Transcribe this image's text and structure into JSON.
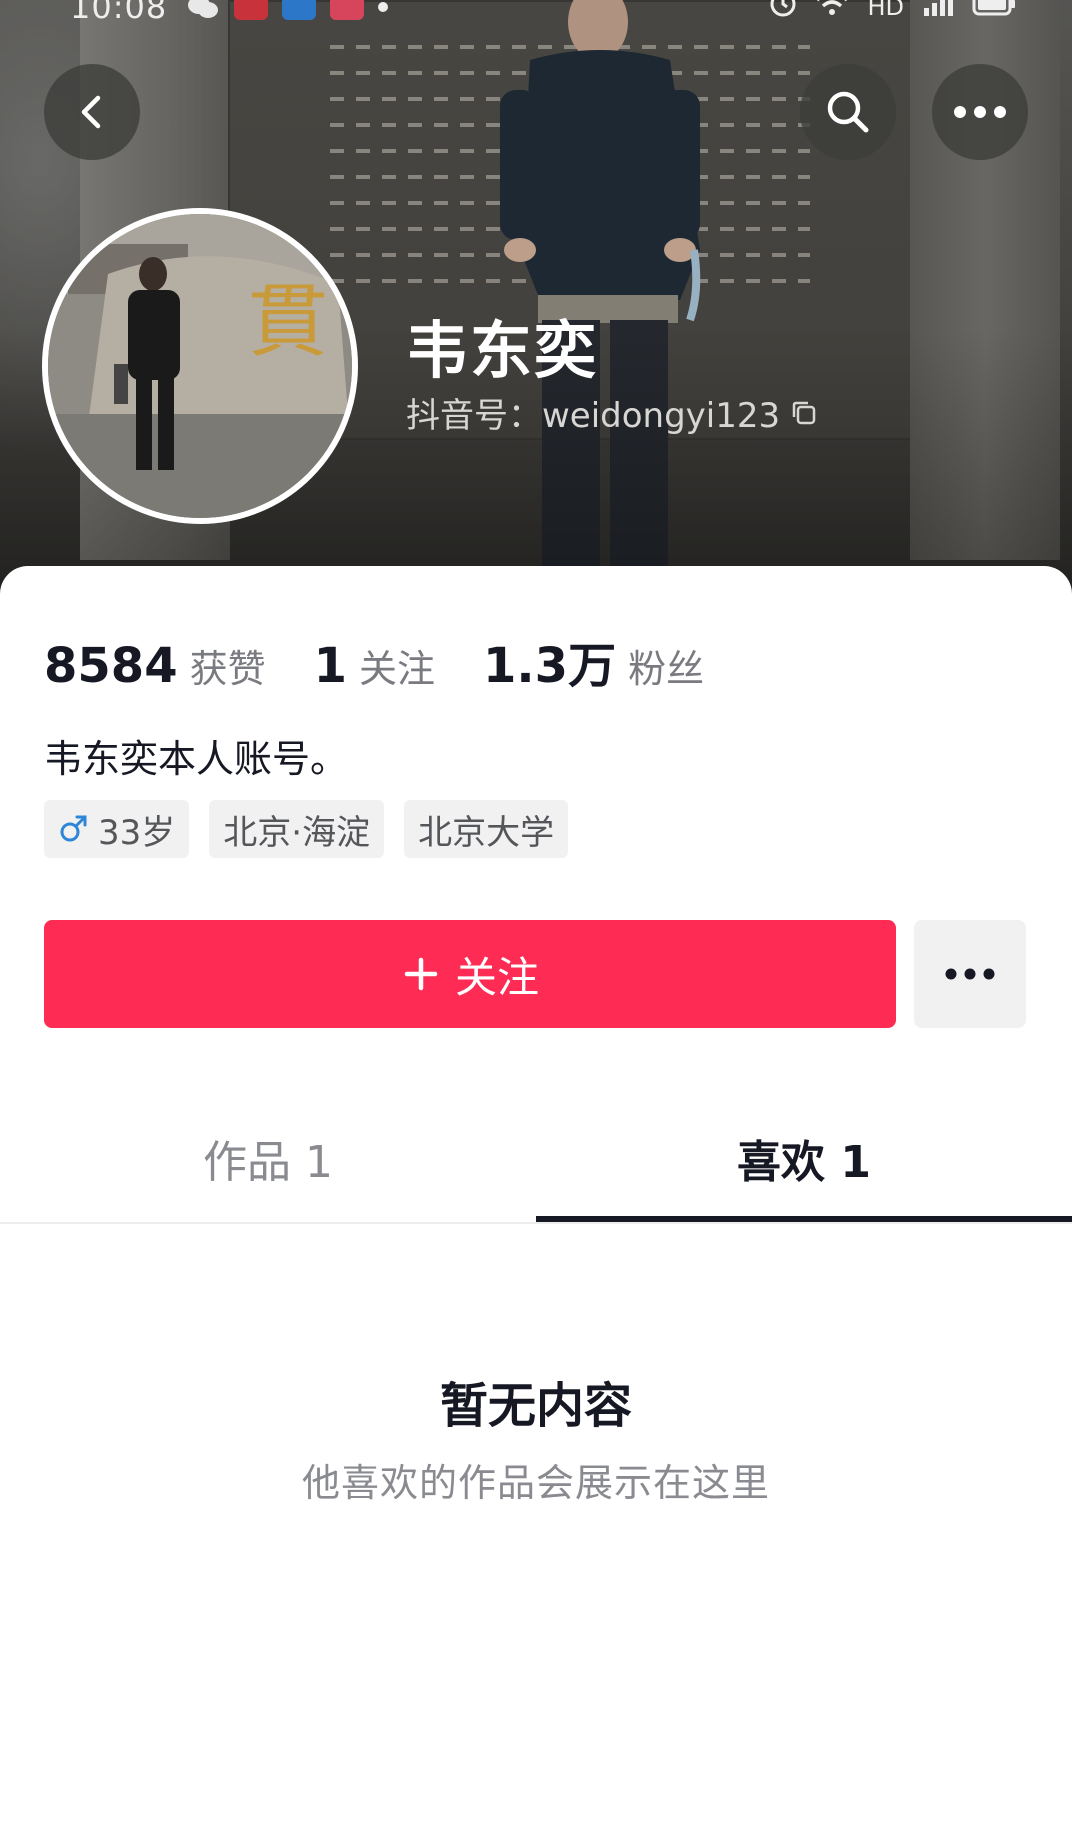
{
  "status_bar": {
    "time": "10:08",
    "network": "HD"
  },
  "header": {
    "back_icon": "chevron-left-icon",
    "search_icon": "search-icon",
    "more_icon": "more-horizontal-icon"
  },
  "profile": {
    "name": "韦东奕",
    "douyin_id": "抖音号：weidongyi123",
    "copy_icon": "copy-icon"
  },
  "stats": [
    {
      "value": "8584",
      "label": "获赞"
    },
    {
      "value": "1",
      "label": "关注"
    },
    {
      "value": "1.3万",
      "label": "粉丝"
    }
  ],
  "bio": "韦东奕本人账号。",
  "tags": [
    {
      "icon": "male-icon",
      "label": "33岁"
    },
    {
      "label": "北京·海淀"
    },
    {
      "label": "北京大学"
    }
  ],
  "actions": {
    "follow_label": "关注",
    "follow_icon": "plus-icon",
    "more_icon": "more-horizontal-icon"
  },
  "tabs": [
    {
      "label": "作品 1",
      "active": false
    },
    {
      "label": "喜欢 1",
      "active": true
    }
  ],
  "empty_state": {
    "title": "暂无内容",
    "subtitle": "他喜欢的作品会展示在这里"
  },
  "colors": {
    "follow_button": "#fe2c55",
    "text_primary": "#161823",
    "text_secondary": "#8a8b90",
    "tag_background": "#f1f1f2"
  }
}
